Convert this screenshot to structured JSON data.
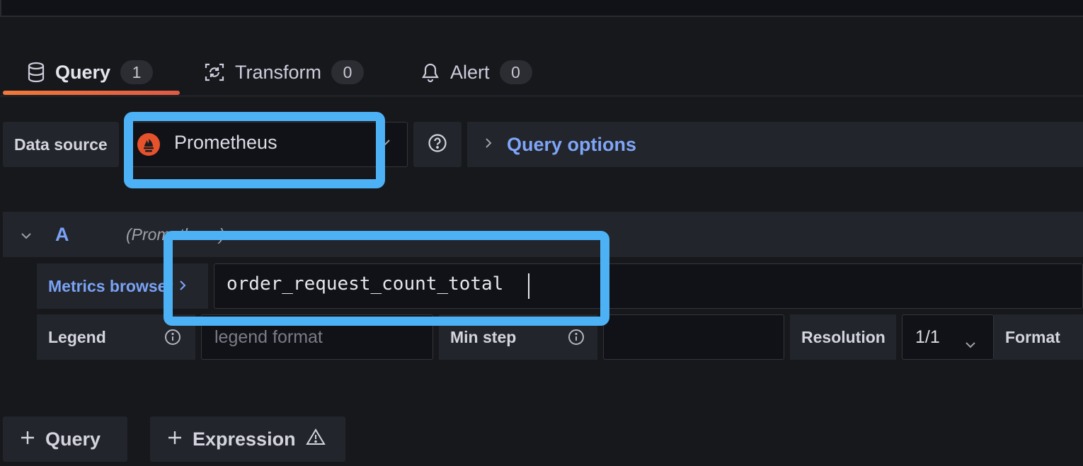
{
  "tabs": [
    {
      "label": "Query",
      "count": "1",
      "icon": "database-icon"
    },
    {
      "label": "Transform",
      "count": "0",
      "icon": "transform-icon"
    },
    {
      "label": "Alert",
      "count": "0",
      "icon": "bell-icon"
    }
  ],
  "data_source": {
    "label": "Data source",
    "selected": "Prometheus",
    "icon": "prometheus-logo",
    "help_icon": "question-circle-icon"
  },
  "query_options": {
    "label": "Query options"
  },
  "query_row": {
    "letter": "A",
    "datasource_hint": "(Prometheus)",
    "metrics_browser_label": "Metrics browser",
    "query_value": "order_request_count_total"
  },
  "options": {
    "legend_label": "Legend",
    "legend_placeholder": "legend format",
    "min_step_label": "Min step",
    "min_step_value": "",
    "resolution_label": "Resolution",
    "resolution_value": "1/1",
    "format_label": "Format"
  },
  "bottom": {
    "add_query": "Query",
    "add_expression": "Expression"
  },
  "colors": {
    "accent_tab": "#f0793a",
    "link_blue": "#7fa5f7",
    "highlight": "#4db1f5",
    "prometheus_orange": "#e6522c"
  }
}
